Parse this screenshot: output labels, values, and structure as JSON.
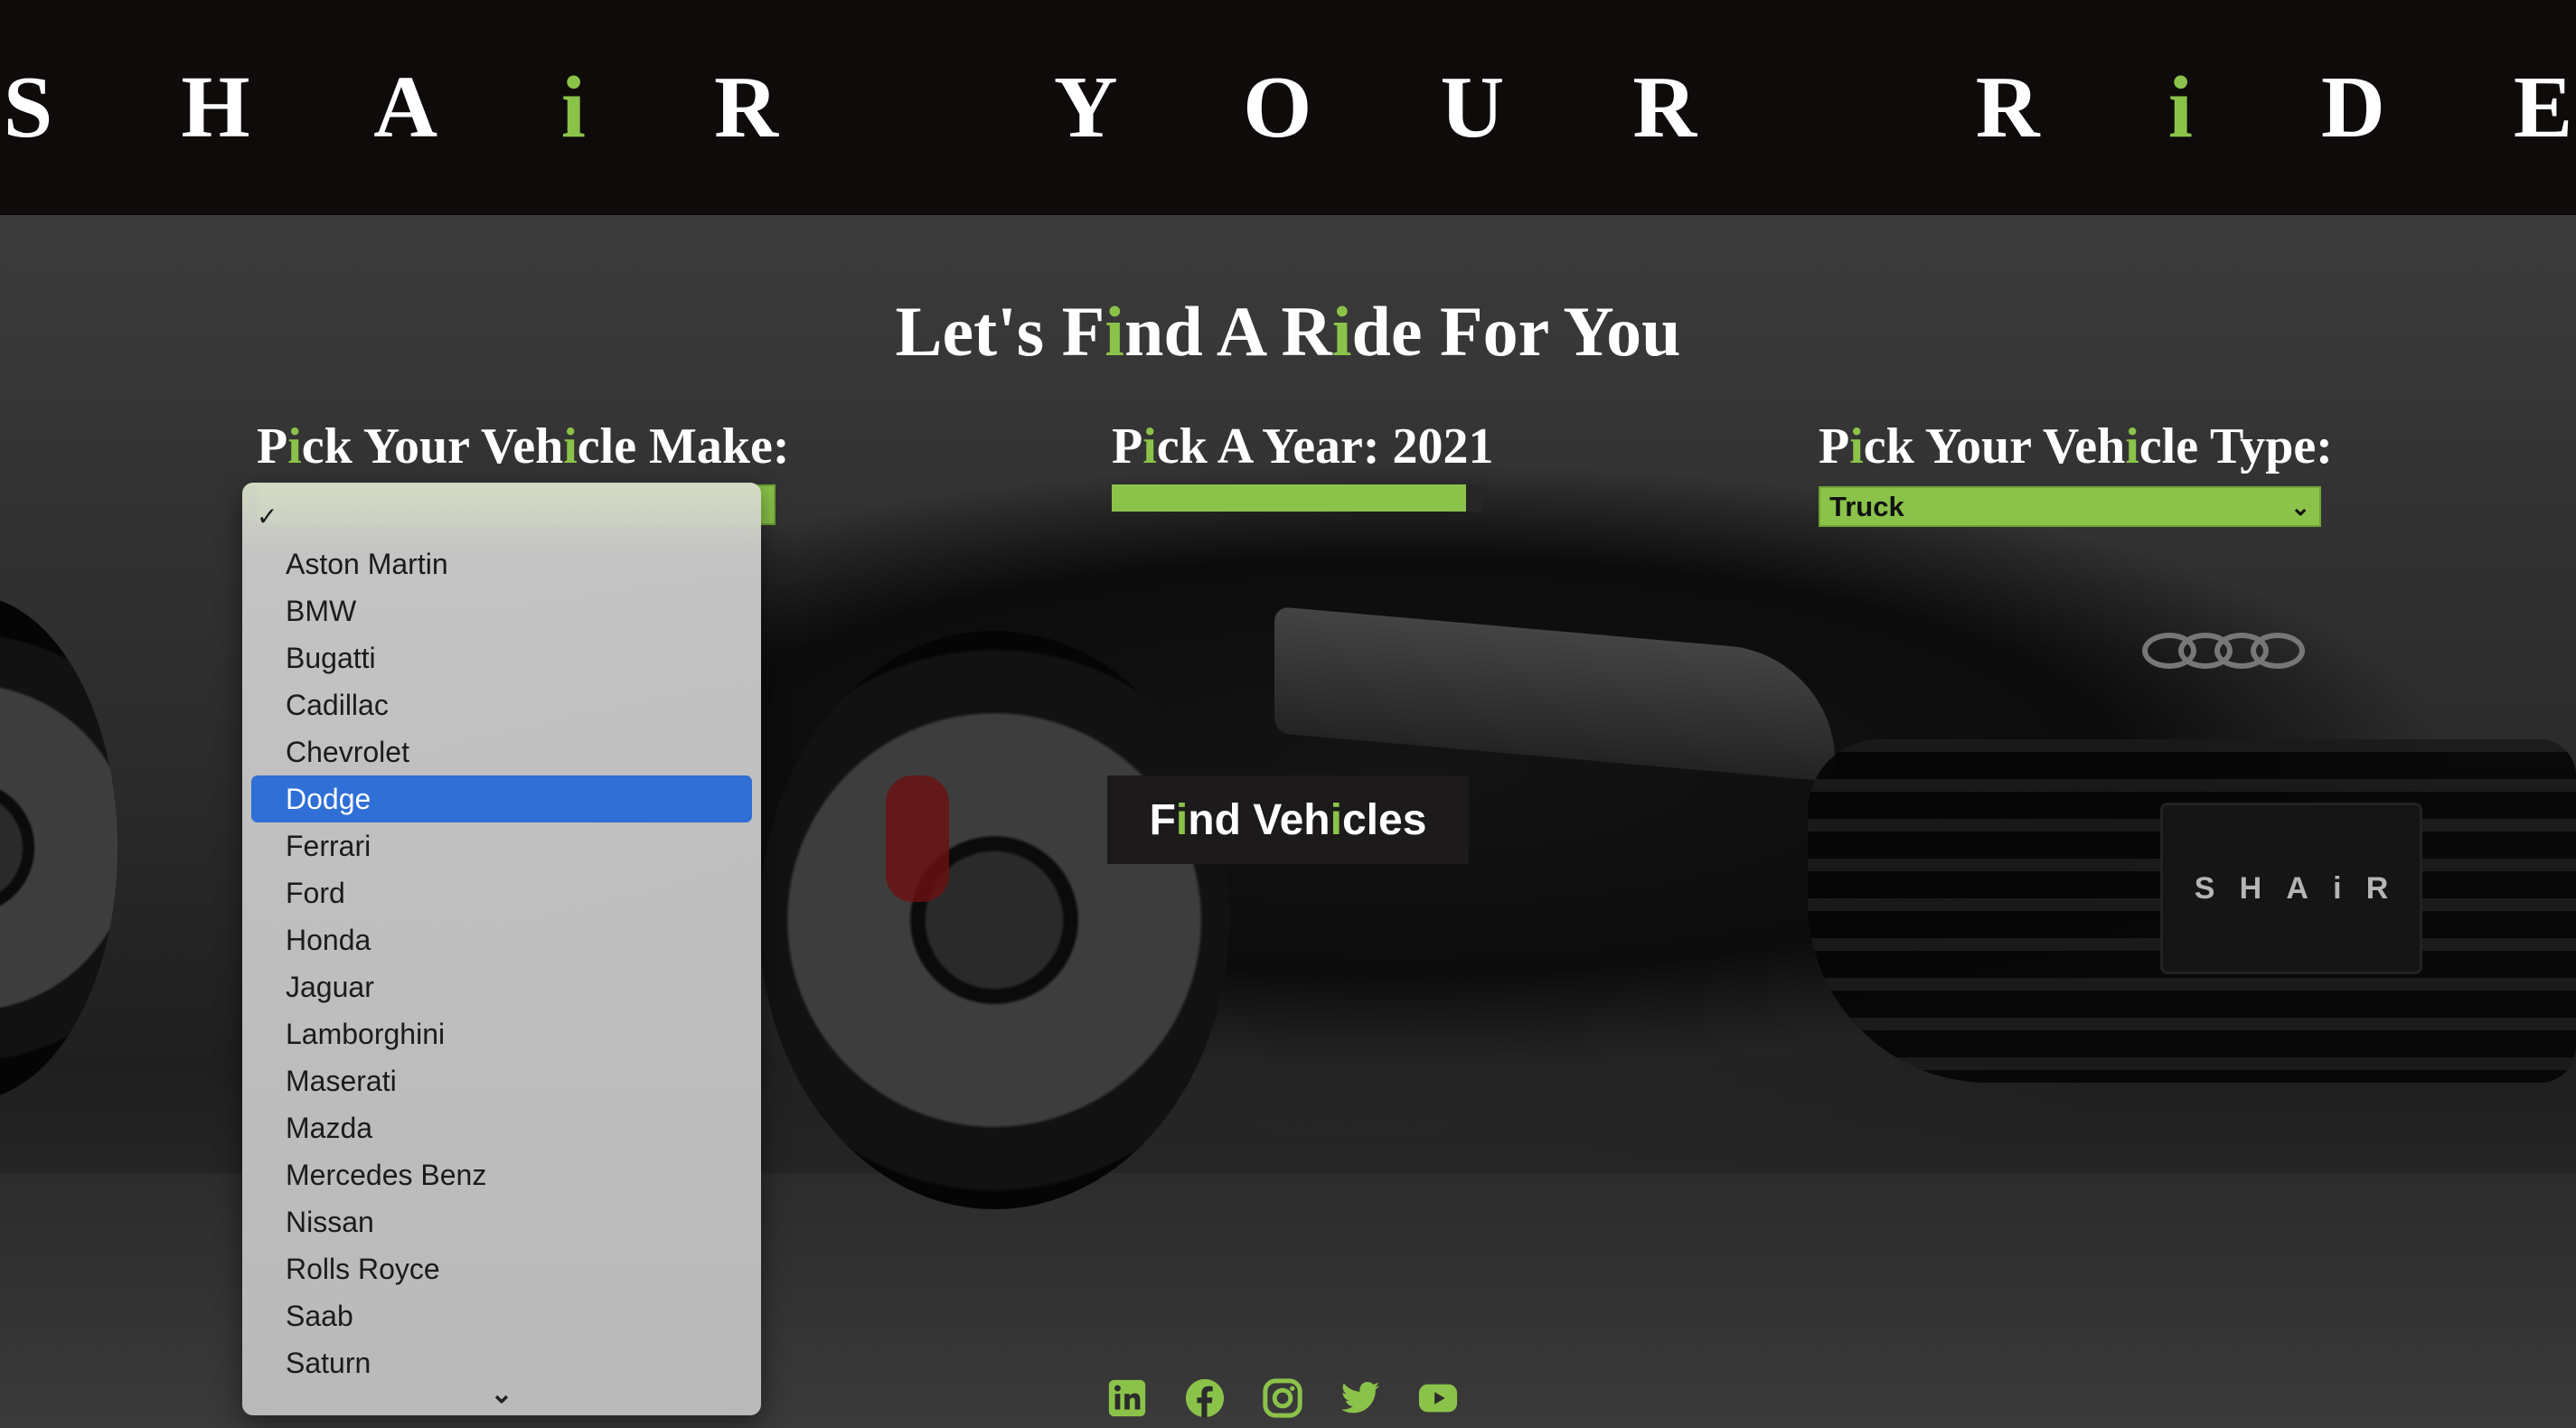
{
  "header": {
    "brand_parts": [
      "S H A ",
      "i",
      " R   Y O U R   R ",
      "i",
      " D E"
    ]
  },
  "main": {
    "heading_parts": [
      "Let's F",
      "i",
      "nd A R",
      "i",
      "de For You"
    ],
    "make": {
      "label_parts": [
        "P",
        "i",
        "ck Your Veh",
        "i",
        "cle Make:"
      ],
      "options": [
        "",
        "Aston Martin",
        "BMW",
        "Bugatti",
        "Cadillac",
        "Chevrolet",
        "Dodge",
        "Ferrari",
        "Ford",
        "Honda",
        "Jaguar",
        "Lamborghini",
        "Maserati",
        "Mazda",
        "Mercedes Benz",
        "Nissan",
        "Rolls Royce",
        "Saab",
        "Saturn"
      ],
      "checked_index": 0,
      "highlighted": "Dodge",
      "more_indicator": "⌄"
    },
    "year": {
      "label_parts": [
        "P",
        "i",
        "ck A Year: 2021"
      ],
      "slider_fraction": 0.955
    },
    "type": {
      "label_parts": [
        "P",
        "i",
        "ck Your Veh",
        "i",
        "cle Type:"
      ],
      "selected": "Truck",
      "chevron": "⌄"
    },
    "find_button_parts": [
      "F",
      "i",
      "nd Veh",
      "i",
      "cles"
    ],
    "plate_text": "SHAiR"
  },
  "social": {
    "icons": [
      "linkedin-icon",
      "facebook-icon",
      "instagram-icon",
      "twitter-icon",
      "youtube-icon"
    ]
  },
  "colors": {
    "accent": "#8bc34a",
    "header_bg": "#0f0b0b",
    "button_bg": "#1c1a1a",
    "dropdown_highlight": "#2f6fd6"
  }
}
